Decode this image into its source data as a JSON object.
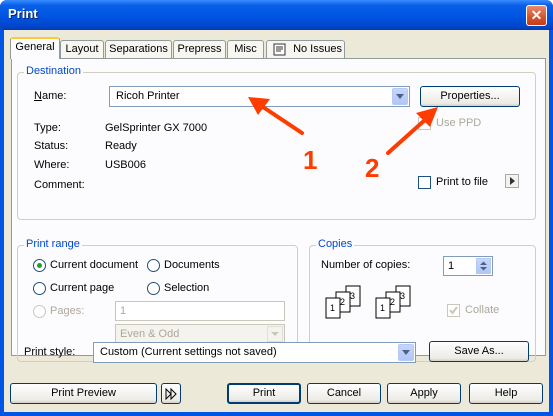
{
  "window": {
    "title": "Print",
    "close_glyph": "✕"
  },
  "tabs": [
    {
      "label": "General",
      "selected": true
    },
    {
      "label": "Layout"
    },
    {
      "label": "Separations"
    },
    {
      "label": "Prepress"
    },
    {
      "label": "Misc"
    },
    {
      "label": "No Issues",
      "icon": "warning-icon"
    }
  ],
  "destination": {
    "group_label": "Destination",
    "name_label": "Name:",
    "name_value": "Ricoh Printer",
    "properties_label": "Properties...",
    "type_label": "Type:",
    "type_value": "GelSprinter GX 7000",
    "status_label": "Status:",
    "status_value": "Ready",
    "where_label": "Where:",
    "where_value": "USB006",
    "comment_label": "Comment:",
    "use_ppd_label": "Use PPD",
    "print_to_file_label": "Print to file"
  },
  "annotations": {
    "arrow1_label": "1",
    "arrow2_label": "2",
    "color": "#ff3c00"
  },
  "print_range": {
    "group_label": "Print range",
    "current_document": "Current document",
    "documents": "Documents",
    "current_page": "Current page",
    "selection": "Selection",
    "pages_label": "Pages:",
    "pages_value": "1",
    "subset_value": "Even & Odd"
  },
  "copies": {
    "group_label": "Copies",
    "number_label": "Number of copies:",
    "number_value": "1",
    "collate_label": "Collate"
  },
  "print_style": {
    "label": "Print style:",
    "value": "Custom (Current settings not saved)",
    "save_as_label": "Save As..."
  },
  "footer": {
    "print_preview": "Print Preview",
    "print": "Print",
    "cancel": "Cancel",
    "apply": "Apply",
    "help": "Help"
  }
}
